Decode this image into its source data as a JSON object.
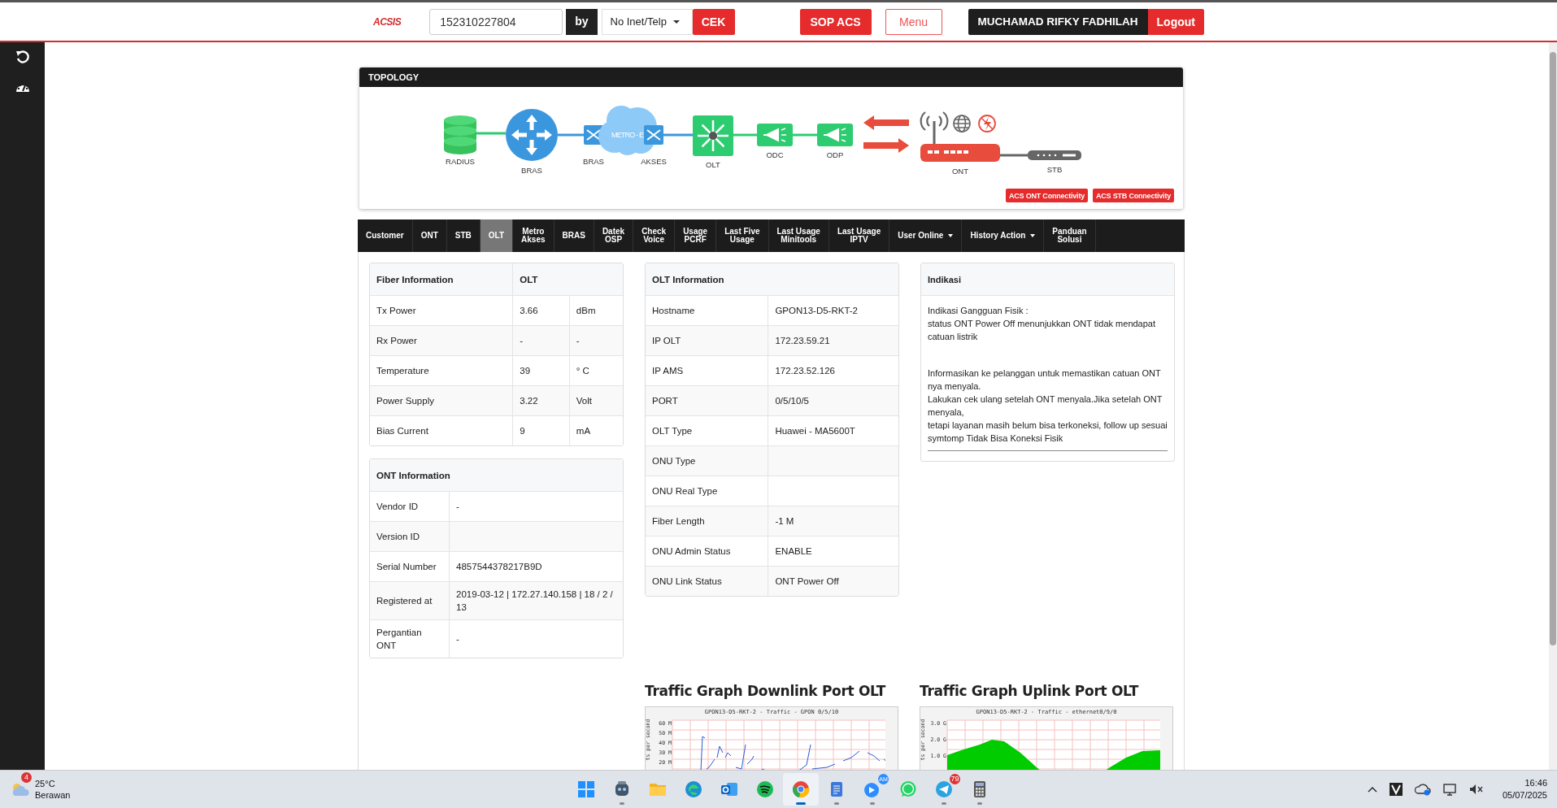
{
  "header": {
    "logo": "ACSIS",
    "search_value": "152310227804",
    "by_label": "by",
    "search_type": "No Inet/Telp",
    "check_button": "CEK",
    "sop_button": "SOP ACS",
    "menu_button": "Menu",
    "user_name": "MUCHAMAD RIFKY FADHILAH",
    "logout_button": "Logout"
  },
  "topology": {
    "title": "TOPOLOGY",
    "nodes": [
      {
        "kind": "radius",
        "label": "RADIUS"
      },
      {
        "kind": "router",
        "label": "BRAS"
      },
      {
        "kind": "switch",
        "label": "BRAS"
      },
      {
        "kind": "cloud",
        "label": "METRO - E"
      },
      {
        "kind": "switch",
        "label": "AKSES"
      },
      {
        "kind": "olt",
        "label": "OLT"
      },
      {
        "kind": "splitter",
        "label": "ODC"
      },
      {
        "kind": "splitter",
        "label": "ODP"
      },
      {
        "kind": "ont",
        "label": "ONT"
      },
      {
        "kind": "stb",
        "label": "STB"
      }
    ],
    "buttons": [
      "ACS ONT Connectivity",
      "ACS STB Connectivity"
    ]
  },
  "tabs": [
    {
      "label": "Customer",
      "selected": false
    },
    {
      "label": "ONT",
      "selected": false
    },
    {
      "label": "STB",
      "selected": false
    },
    {
      "label": "OLT",
      "selected": true
    },
    {
      "label": "Metro\nAkses",
      "selected": false
    },
    {
      "label": "BRAS",
      "selected": false
    },
    {
      "label": "Datek\nOSP",
      "selected": false
    },
    {
      "label": "Check\nVoice",
      "selected": false
    },
    {
      "label": "Usage\nPCRF",
      "selected": false
    },
    {
      "label": "Last Five\nUsage",
      "selected": false
    },
    {
      "label": "Last Usage\nMinitools",
      "selected": false
    },
    {
      "label": "Last Usage\nIPTV",
      "selected": false
    },
    {
      "label": "User Online",
      "selected": false,
      "dropdown": true
    },
    {
      "label": "History Action",
      "selected": false,
      "dropdown": true
    },
    {
      "label": "Panduan\nSolusi",
      "selected": false
    }
  ],
  "fiber_information": {
    "headers": [
      "Fiber Information",
      "OLT"
    ],
    "rows": [
      [
        "Tx Power",
        "3.66",
        "dBm"
      ],
      [
        "Rx Power",
        "-",
        "-"
      ],
      [
        "Temperature",
        "39",
        "° C"
      ],
      [
        "Power Supply",
        "3.22",
        "Volt"
      ],
      [
        "Bias Current",
        "9",
        "mA"
      ]
    ]
  },
  "ont_information": {
    "title": "ONT Information",
    "rows": [
      [
        "Vendor ID",
        "-"
      ],
      [
        "Version ID"
      ],
      [
        "Serial Number",
        "4857544378217B9D"
      ],
      [
        "Registered at",
        "2019-03-12 | 172.27.140.158 | 18 / 2 / 13"
      ],
      [
        "Pergantian ONT",
        "-"
      ]
    ]
  },
  "olt_information": {
    "title": "OLT Information",
    "rows": [
      [
        "Hostname",
        "GPON13-D5-RKT-2"
      ],
      [
        "IP OLT",
        "172.23.59.21"
      ],
      [
        "IP AMS",
        "172.23.52.126"
      ],
      [
        "PORT",
        "0/5/10/5"
      ],
      [
        "OLT Type",
        "Huawei - MA5600T"
      ],
      [
        "ONU Type"
      ],
      [
        "ONU Real Type"
      ],
      [
        "Fiber Length",
        "-1 M"
      ],
      [
        "ONU Admin Status",
        "ENABLE"
      ],
      [
        "ONU Link Status",
        "ONT Power Off"
      ]
    ]
  },
  "indikasi": {
    "title": "Indikasi",
    "paragraphs": [
      [
        "Indikasi Gangguan Fisik :",
        "status ONT Power Off menunjukkan ONT tidak mendapat catuan listrik"
      ],
      [
        "Informasikan ke pelanggan untuk memastikan catuan ONT nya menyala.",
        "Lakukan cek ulang setelah ONT menyala.Jika setelah ONT menyala,",
        "tetapi layanan masih belum bisa terkoneksi, follow up sesuai symtomp Tidak Bisa Koneksi Fisik"
      ]
    ]
  },
  "graphs": [
    {
      "kind": "scatter",
      "title": "Traffic Graph Downlink Port OLT",
      "graph_title": "GPON13-D5-RKT-2 - Traffic - GPON 0/5/10",
      "y_label": "ts per second",
      "y_ticks": [
        "60 M",
        "50 M",
        "40 M",
        "30 M",
        "20 M"
      ]
    },
    {
      "kind": "area",
      "title": "Traffic Graph Uplink Port OLT",
      "graph_title": "GPON13-D5-RKT-2 - Traffic - ethernet0/9/0",
      "y_label": "ts per second",
      "y_ticks": [
        "3.0 G",
        "2.0 G",
        "1.0 G"
      ]
    }
  ],
  "taskbar": {
    "weather": {
      "temperature": "25°C",
      "condition": "Berawan",
      "badge": "4"
    },
    "apps": [
      {
        "kind": "start",
        "running": false,
        "active": false
      },
      {
        "kind": "robot",
        "running": true,
        "active": false
      },
      {
        "kind": "folder",
        "running": false,
        "active": false
      },
      {
        "kind": "edge",
        "running": false,
        "active": false
      },
      {
        "kind": "outlook",
        "running": false,
        "active": false
      },
      {
        "kind": "spotify",
        "running": false,
        "active": false
      },
      {
        "kind": "chrome",
        "running": true,
        "active": true
      },
      {
        "kind": "notepad",
        "running": true,
        "active": false
      },
      {
        "kind": "meeting",
        "running": true,
        "active": false,
        "badge": "AM"
      },
      {
        "kind": "whatsapp",
        "running": false,
        "active": false
      },
      {
        "kind": "telegram",
        "running": true,
        "active": false,
        "badge": "79"
      },
      {
        "kind": "calculator",
        "running": true,
        "active": false
      }
    ],
    "clock": {
      "time": "16:46",
      "date": "05/07/2025"
    }
  }
}
